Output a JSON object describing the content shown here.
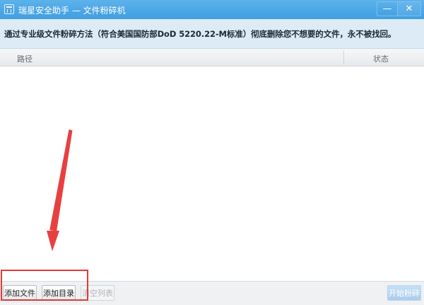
{
  "window": {
    "title": "瑞星安全助手 — 文件粉碎机",
    "controls": {
      "minimize": "—",
      "close": "✕"
    }
  },
  "banner": {
    "text": "通过专业级文件粉碎方法（符合美国国防部DoD 5220.22-M标准）彻底删除您不想要的文件，永不被找回。"
  },
  "table": {
    "columns": [
      "路径",
      "状态"
    ],
    "rows": []
  },
  "toolbar": {
    "add_file_label": "添加文件",
    "add_dir_label": "添加目录",
    "clear_label": "清空列表",
    "start_label": "开始粉碎"
  },
  "colors": {
    "titlebar": "#3f9ee2",
    "banner": "#ddebf6",
    "annotation": "#e03a3a"
  },
  "icons": {
    "app": "shredder-icon",
    "minimize": "minimize-icon",
    "close": "close-icon",
    "annotation_arrow": "arrow-icon"
  }
}
